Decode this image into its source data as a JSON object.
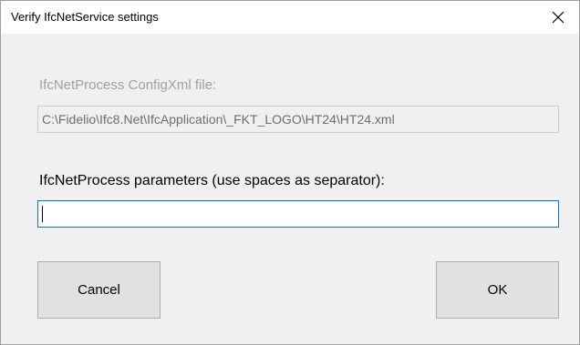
{
  "window": {
    "title": "Verify IfcNetService settings",
    "close_icon": "close-icon"
  },
  "config": {
    "label": "IfcNetProcess ConfigXml file:",
    "value": "C:\\Fidelio\\Ifc8.Net\\IfcApplication\\_FKT_LOGO\\HT24\\HT24.xml"
  },
  "params": {
    "label": "IfcNetProcess parameters (use spaces as separator):",
    "value": ""
  },
  "buttons": {
    "cancel_label": "Cancel",
    "ok_label": "OK"
  },
  "colors": {
    "dialog_background": "#f0f0f0",
    "focus_border": "#0078d7",
    "disabled_text": "#a0a0a0",
    "button_face": "#e1e1e1"
  }
}
